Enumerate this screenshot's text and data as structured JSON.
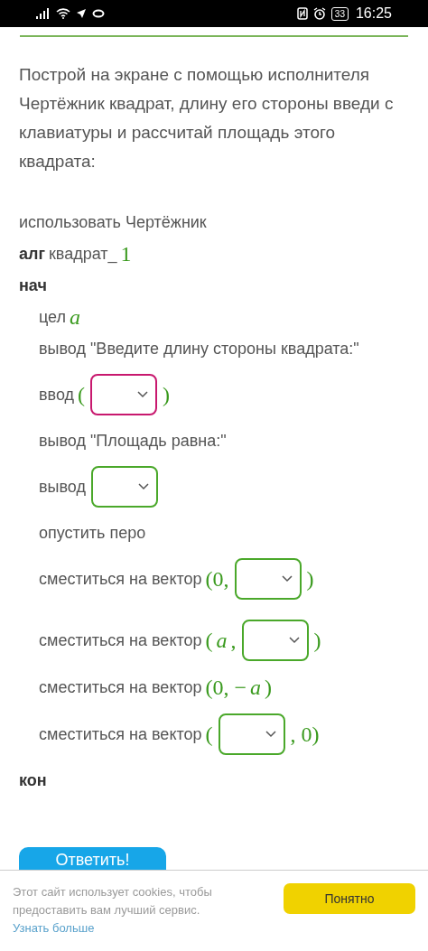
{
  "status_bar": {
    "battery": "33",
    "time": "16:25"
  },
  "task": "Построй на экране с помощью исполнителя Чертёжник квадрат, длину его стороны введи с клавиатуры и рассчитай площадь этого квадрата:",
  "program": [
    {
      "segments": [
        {
          "kind": "plain",
          "text": "использовать Чертёжник"
        }
      ]
    },
    {
      "segments": [
        {
          "kind": "keyword",
          "text": "алг"
        },
        {
          "kind": "plain",
          "text": "квадрат_"
        },
        {
          "kind": "math",
          "text": "1"
        }
      ]
    },
    {
      "segments": [
        {
          "kind": "keyword",
          "text": "нач"
        }
      ],
      "children": [
        {
          "segments": [
            {
              "kind": "plain",
              "text": "цел"
            },
            {
              "kind": "math-italic",
              "text": "a"
            }
          ]
        },
        {
          "segments": [
            {
              "kind": "plain",
              "text": "вывод \"Введите длину стороны квадрата:\""
            }
          ]
        },
        {
          "segments": [
            {
              "kind": "plain",
              "text": "ввод"
            },
            {
              "kind": "math",
              "text": "("
            },
            {
              "kind": "select",
              "focused": true
            },
            {
              "kind": "math",
              "text": ")"
            }
          ]
        },
        {
          "segments": [
            {
              "kind": "plain",
              "text": "вывод \"Площадь равна:\""
            }
          ]
        },
        {
          "segments": [
            {
              "kind": "plain",
              "text": "вывод"
            },
            {
              "kind": "select",
              "focused": false
            }
          ]
        },
        {
          "segments": [
            {
              "kind": "plain",
              "text": "опустить перо"
            }
          ]
        },
        {
          "segments": [
            {
              "kind": "plain",
              "text": "сместиться на вектор"
            },
            {
              "kind": "math",
              "text": "(0,"
            },
            {
              "kind": "select",
              "focused": false
            },
            {
              "kind": "math",
              "text": ")"
            }
          ]
        },
        {
          "segments": [
            {
              "kind": "plain",
              "text": "сместиться на вектор"
            },
            {
              "kind": "math",
              "text": "("
            },
            {
              "kind": "math-italic",
              "text": "a"
            },
            {
              "kind": "math",
              "text": ","
            },
            {
              "kind": "select",
              "focused": false
            },
            {
              "kind": "math",
              "text": ")"
            }
          ]
        },
        {
          "segments": [
            {
              "kind": "plain",
              "text": "сместиться на вектор"
            },
            {
              "kind": "math",
              "text": "(0, −"
            },
            {
              "kind": "math-italic",
              "text": "a"
            },
            {
              "kind": "math",
              "text": ")"
            }
          ]
        },
        {
          "segments": [
            {
              "kind": "plain",
              "text": "сместиться на вектор"
            },
            {
              "kind": "math",
              "text": "("
            },
            {
              "kind": "select",
              "focused": false
            },
            {
              "kind": "math",
              "text": ", 0)"
            }
          ]
        }
      ]
    },
    {
      "segments": [
        {
          "kind": "keyword",
          "text": "кон"
        }
      ]
    }
  ],
  "answer_button": "Ответить!",
  "cookie_banner": {
    "text": "Этот сайт использует cookies, чтобы предоставить вам лучший сервис.",
    "link": "Узнать больше",
    "button": "Понятно"
  }
}
